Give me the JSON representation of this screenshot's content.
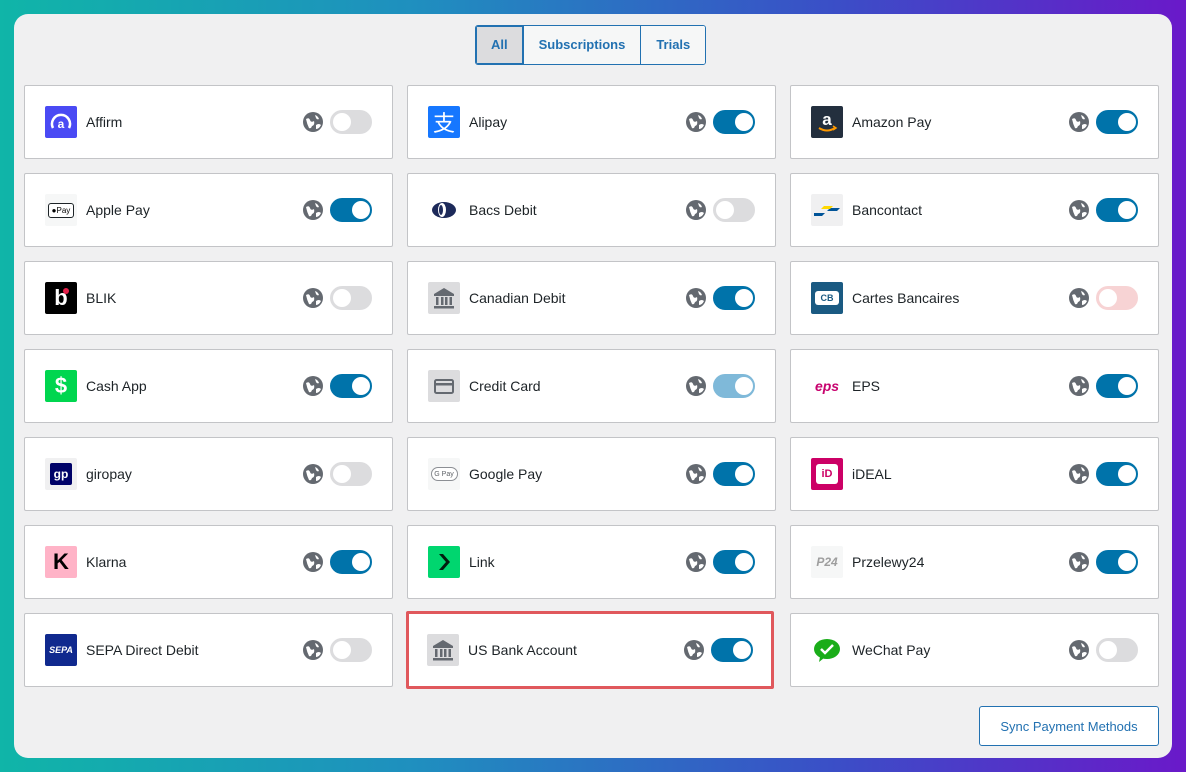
{
  "tabs": [
    {
      "label": "All",
      "active": true
    },
    {
      "label": "Subscriptions",
      "active": false
    },
    {
      "label": "Trials",
      "active": false
    }
  ],
  "methods": [
    {
      "name": "Affirm",
      "icon": "affirm-logo",
      "toggle": "off"
    },
    {
      "name": "Alipay",
      "icon": "alipay-logo",
      "toggle": "on"
    },
    {
      "name": "Amazon Pay",
      "icon": "amazon-pay-logo",
      "toggle": "on"
    },
    {
      "name": "Apple Pay",
      "icon": "apple-pay-logo",
      "toggle": "on"
    },
    {
      "name": "Bacs Debit",
      "icon": "bacs-debit-logo",
      "toggle": "off"
    },
    {
      "name": "Bancontact",
      "icon": "bancontact-logo",
      "toggle": "on"
    },
    {
      "name": "BLIK",
      "icon": "blik-logo",
      "toggle": "off"
    },
    {
      "name": "Canadian Debit",
      "icon": "bank-icon",
      "toggle": "on"
    },
    {
      "name": "Cartes Bancaires",
      "icon": "cartes-bancaires-logo",
      "toggle": "disabled-off"
    },
    {
      "name": "Cash App",
      "icon": "cash-app-logo",
      "toggle": "on"
    },
    {
      "name": "Credit Card",
      "icon": "credit-card-icon",
      "toggle": "disabled-on"
    },
    {
      "name": "EPS",
      "icon": "eps-logo",
      "toggle": "on"
    },
    {
      "name": "giropay",
      "icon": "giropay-logo",
      "toggle": "off"
    },
    {
      "name": "Google Pay",
      "icon": "google-pay-logo",
      "toggle": "on"
    },
    {
      "name": "iDEAL",
      "icon": "ideal-logo",
      "toggle": "on"
    },
    {
      "name": "Klarna",
      "icon": "klarna-logo",
      "toggle": "on"
    },
    {
      "name": "Link",
      "icon": "link-logo",
      "toggle": "on"
    },
    {
      "name": "Przelewy24",
      "icon": "przelewy24-logo",
      "toggle": "on"
    },
    {
      "name": "SEPA Direct Debit",
      "icon": "sepa-logo",
      "toggle": "off"
    },
    {
      "name": "US Bank Account",
      "icon": "bank-icon",
      "toggle": "on",
      "highlighted": true
    },
    {
      "name": "WeChat Pay",
      "icon": "wechat-pay-logo",
      "toggle": "off"
    }
  ],
  "sync_button": "Sync Payment Methods",
  "logo_text": {
    "apple_pay": "Pay",
    "google_pay": "G Pay",
    "giropay": "gp",
    "eps": "eps",
    "sepa": "SEPA",
    "p24": "P24",
    "ideal": "iD",
    "cash": "$",
    "klarna": "K",
    "alipay": "支",
    "affirm": "a",
    "amazon": "a",
    "blik": "b",
    "cb": "CB"
  },
  "colors": {
    "accent": "#2271b1",
    "toggle_on": "#0073aa",
    "highlight_border": "#e0585c"
  }
}
